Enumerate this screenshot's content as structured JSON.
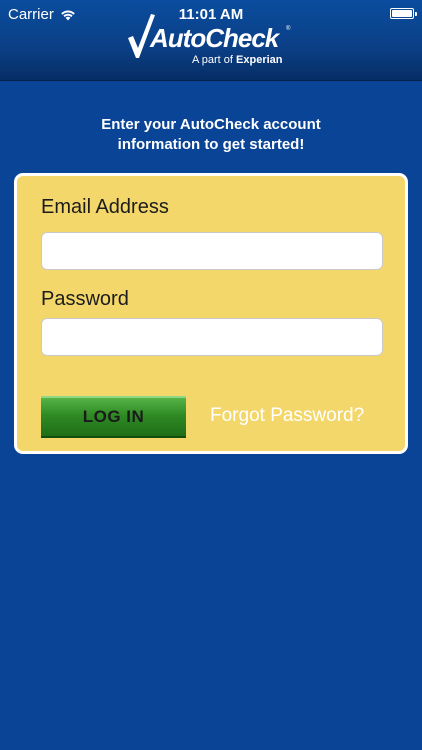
{
  "status_bar": {
    "carrier": "Carrier",
    "time": "11:01 AM",
    "wifi_icon": "wifi-icon",
    "battery_icon": "battery-icon"
  },
  "header": {
    "logo_text": "AutoCheck",
    "logo_tagline_prefix": "A part of",
    "logo_tagline_brand": "Experian",
    "logo_icon": "checkmark-icon",
    "background_color": "#0b3f86"
  },
  "intro": {
    "line1": "Enter your AutoCheck account",
    "line2": "information to get started!"
  },
  "form": {
    "email_label": "Email Address",
    "email_value": "",
    "email_placeholder": "",
    "password_label": "Password",
    "password_value": "",
    "password_placeholder": "",
    "login_label": "LOG IN",
    "forgot_label": "Forgot Password?",
    "card_color": "#f4d76b",
    "button_color": "#2f8a24"
  },
  "page": {
    "background_color": "#0a4497"
  }
}
